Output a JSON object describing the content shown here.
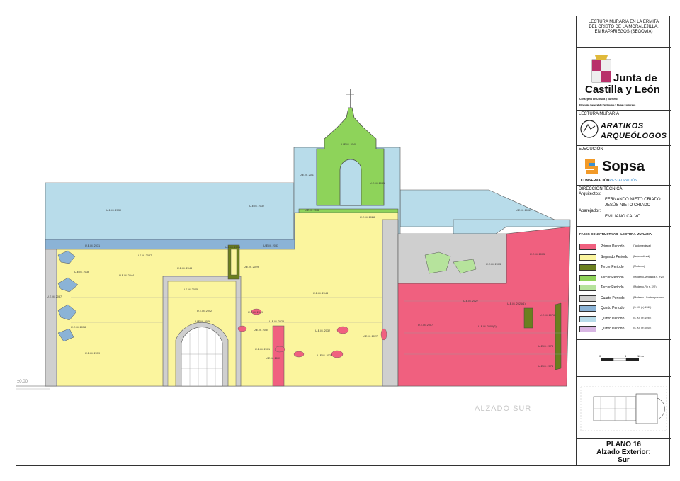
{
  "title_block": {
    "project_title": [
      "LECTURA MURARIA EN LA ERMITA",
      "DEL CRISTO DE LA MORALEJILLA,",
      "EN RAPARIEGOS (SEGOVIA)"
    ],
    "junta_line1": "Junta de",
    "junta_line2": "Castilla y León",
    "consejeria": "Consejería de Cultura y Turismo",
    "direccion_general": "Dirección General de Patrimonio y Bienes Culturales",
    "lectura_label": "LECTURA MURARIA",
    "aratikos_line1": "ARATIKOS",
    "aratikos_line2": "ARQUEÓLOGOS",
    "ejecucion_label": "EJECUCIÓN",
    "sopsa_name": "Sopsa",
    "sopsa_tagline_a": "CONSERVACIÓN",
    "sopsa_tagline_b": "RESTAURACIÓN",
    "direccion_tecnica": "DIRECCIÓN TÉCNICA",
    "arquitectos_label": "Arquitectos:",
    "arquitecto_1": "FERNANDO NIETO CRIADO",
    "arquitecto_2": "JESÚS NIETO CRIADO",
    "aparejador_label": "Aparejador:",
    "aparejador": "EMILIANO CALVO",
    "legend_header_a": "FASES CONSTRUCTIVAS",
    "legend_header_b": "LECTURA MURARIA",
    "plan_number": "PLANO 16",
    "plan_title_1": "Alzado Exterior:",
    "plan_title_2": "Sur"
  },
  "legend": [
    {
      "label": "Primer Periodo",
      "note": "(Tardomedieval)",
      "color": "#f0607f"
    },
    {
      "label": "Segundo Periodo",
      "note": "(Bajomedieval)",
      "color": "#fbf59e"
    },
    {
      "label": "Tercer Periodo",
      "note": "(Moderno)",
      "color": "#6b7f1f"
    },
    {
      "label": "Tercer Periodo",
      "note": "(Moderno-Mediados s. XVI)",
      "color": "#8ed35a"
    },
    {
      "label": "Tercer Periodo",
      "note": "(Moderno-Fin s. XVI)",
      "color": "#b6e39c"
    },
    {
      "label": "Cuarto Periodo",
      "note": "(Moderno / Contemporáneo)",
      "color": "#cfcfcf"
    },
    {
      "label": "Quinto Periodo",
      "note": "(S. XX (h)  1960)",
      "color": "#8bb3d6"
    },
    {
      "label": "Quinto Periodo",
      "note": "(S. XX (h)  1990)",
      "color": "#b8dcea"
    },
    {
      "label": "Quinto Periodo",
      "note": "(S. XX (h)  2000)",
      "color": "#d8b6e3"
    }
  ],
  "scale_labels": [
    "0",
    "5",
    "10 m"
  ],
  "drawing": {
    "elevation_label": "ALZADO SUR",
    "datum_label": "±0,00",
    "colors": {
      "roof": "#b8dcea",
      "yellow": "#fbf59e",
      "pink": "#f0607f",
      "green": "#8ed35a",
      "olive": "#6b7f1f",
      "gray": "#cfcfcf",
      "blue_band": "#8bb3d6",
      "light_green": "#b6e39c"
    },
    "ue_labels": [
      "U.E.M. 2040",
      "U.E.M. 2041",
      "U.E.M. 2030",
      "U.E.M. 2032",
      "U.E.M. 2031",
      "U.E.M. 2032",
      "U.E.M. 2033",
      "U.E.M. 2035",
      "U.E.M. 2037",
      "U.E.M. 2033",
      "U.E.M. 2028",
      "U.E.M. 2044",
      "U.E.M. 2044",
      "U.E.M. 2045",
      "U.E.M. 2046",
      "U.E.M. 2036",
      "U.E.M. 2037",
      "U.E.M. 2038",
      "U.E.M. 2039",
      "U.E.M. 2043",
      "U.E.M. 2042",
      "U.E.M. 2049",
      "U.E.M. 2025",
      "U.E.M. 2029",
      "U.E.M. 2032",
      "U.E.M. 2034",
      "U.E.M. 2009",
      "U.E.M. 2027",
      "U.E.M. 2001",
      "U.E.M. 2027",
      "U.E.M. 2007",
      "U.E.M. 2027",
      "U.E.M. 2026(1)",
      "U.E.M. 2006(2)",
      "U.E.M. 2076",
      "U.E.M. 2073",
      "U.E.M. 2074",
      "U.E.M. 2003",
      "U.E.M. 2002",
      "U.E.M. 2005"
    ]
  }
}
